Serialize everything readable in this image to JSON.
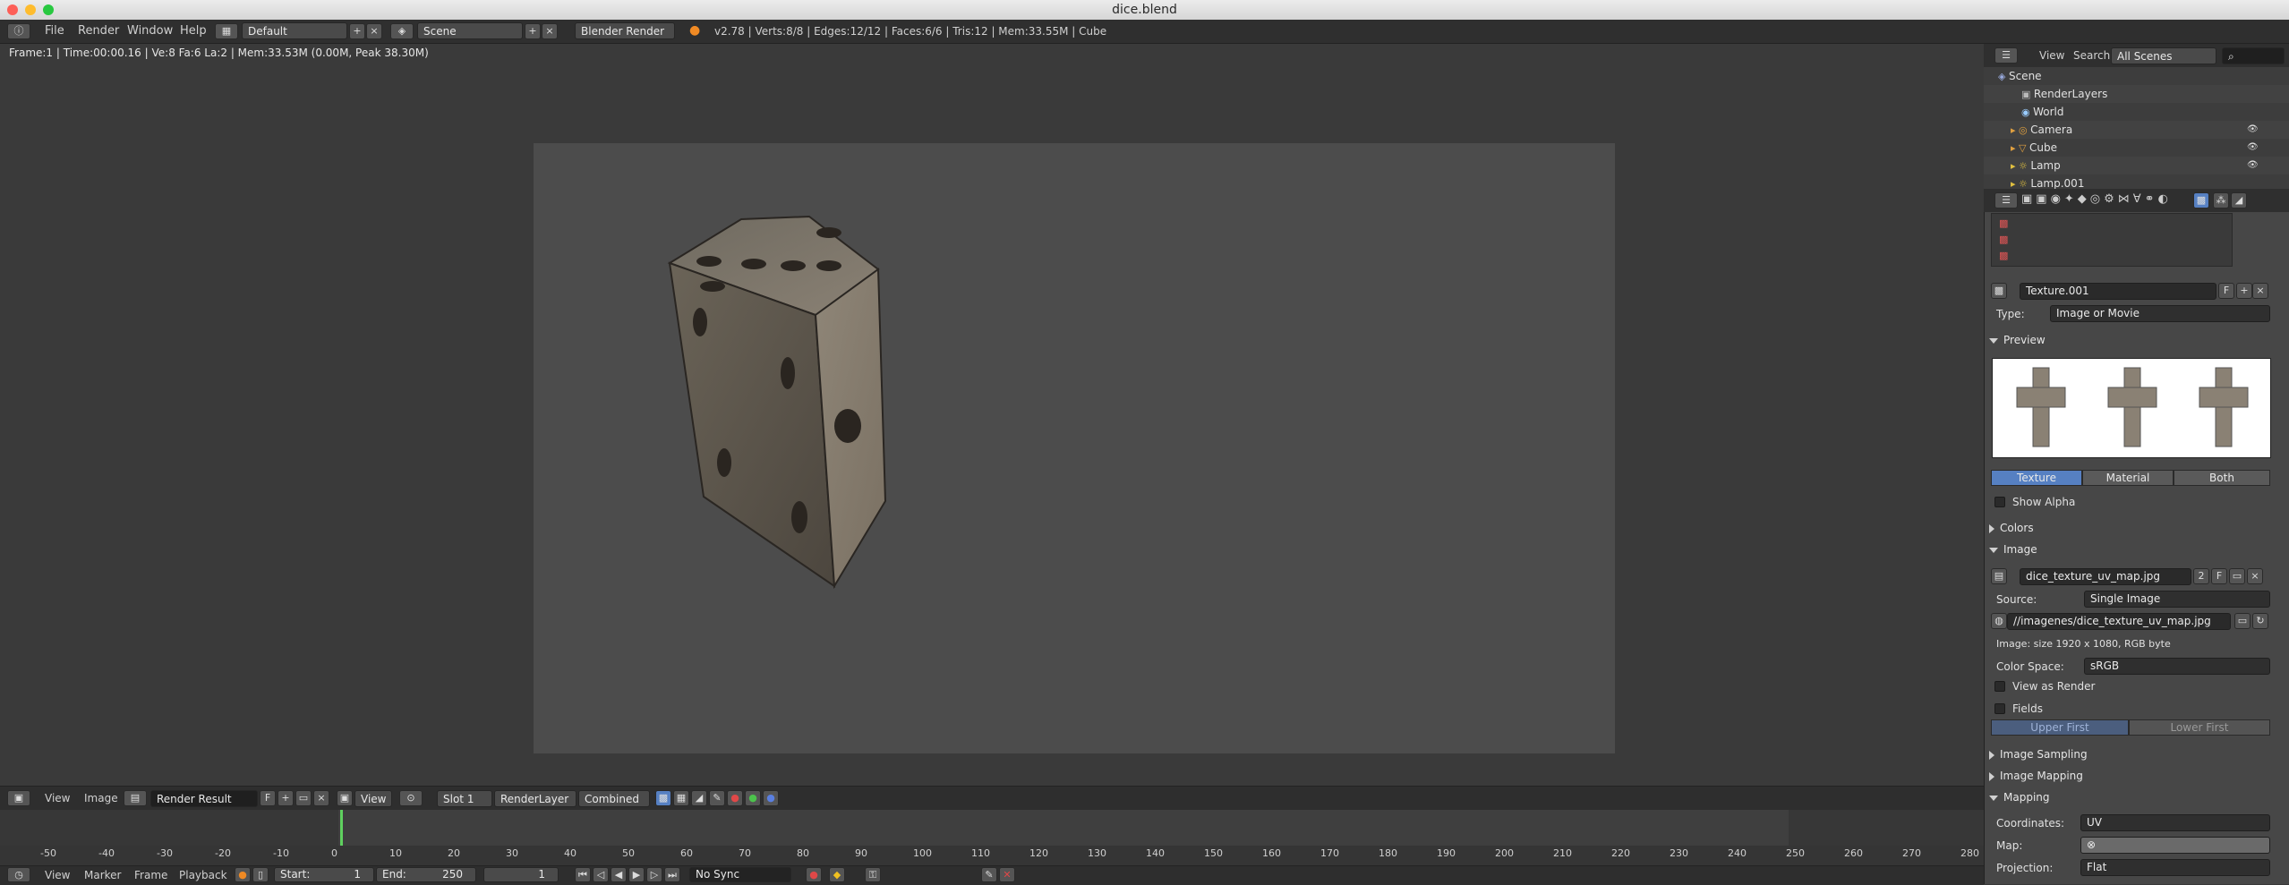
{
  "window": {
    "title": "dice.blend"
  },
  "topbar": {
    "menus": [
      "File",
      "Render",
      "Window",
      "Help"
    ],
    "layout": "Default",
    "scene": "Scene",
    "engine": "Blender Render",
    "stats": "v2.78 | Verts:8/8 | Edges:12/12 | Faces:6/6 | Tris:12 | Mem:33.55M | Cube"
  },
  "viewport": {
    "info": "Frame:1 | Time:00:00.16 | Ve:8 Fa:6 La:2 | Mem:33.53M (0.00M, Peak 38.30M)"
  },
  "image_editor": {
    "menus": [
      "View",
      "Image"
    ],
    "image_name": "Render Result",
    "f_label": "F",
    "view": "View",
    "slot": "Slot 1",
    "layer": "RenderLayer",
    "pass": "Combined"
  },
  "timeline": {
    "ticks": [
      "-50",
      "-40",
      "-30",
      "-20",
      "-10",
      "0",
      "10",
      "20",
      "30",
      "40",
      "50",
      "60",
      "70",
      "80",
      "90",
      "100",
      "110",
      "120",
      "130",
      "140",
      "150",
      "160",
      "170",
      "180",
      "190",
      "200",
      "210",
      "220",
      "230",
      "240",
      "250",
      "260",
      "270",
      "280"
    ],
    "menus": [
      "View",
      "Marker",
      "Frame",
      "Playback"
    ],
    "start_label": "Start:",
    "start_value": "1",
    "end_label": "End:",
    "end_value": "250",
    "current": "1",
    "sync": "No Sync"
  },
  "outliner": {
    "view": "View",
    "search": "Search",
    "filter": "All Scenes",
    "rows": [
      "Scene",
      "RenderLayers",
      "World",
      "Camera",
      "Cube",
      "Lamp",
      "Lamp.001"
    ]
  },
  "properties": {
    "texture_name": "Texture.001",
    "f_label": "F",
    "type_label": "Type:",
    "type_value": "Image or Movie",
    "preview_label": "Preview",
    "preview_tabs": [
      "Texture",
      "Material",
      "Both"
    ],
    "show_alpha": "Show Alpha",
    "colors": "Colors",
    "image_panel": "Image",
    "image_name": "dice_texture_uv_map.jpg",
    "image_users": "2",
    "source_label": "Source:",
    "source_value": "Single Image",
    "filepath": "//imagenes/dice_texture_uv_map.jpg",
    "image_info": "Image: size 1920 x 1080, RGB byte",
    "colorspace_label": "Color Space:",
    "colorspace_value": "sRGB",
    "view_as_render": "View as Render",
    "fields": "Fields",
    "field_order": [
      "Upper First",
      "Lower First"
    ],
    "image_sampling": "Image Sampling",
    "image_mapping": "Image Mapping",
    "mapping": "Mapping",
    "coords_label": "Coordinates:",
    "coords_value": "UV",
    "map_label": "Map:",
    "projection_label": "Projection:",
    "projection_value": "Flat"
  },
  "colors": {
    "accent": "#5680c2",
    "bg": "#393939"
  }
}
